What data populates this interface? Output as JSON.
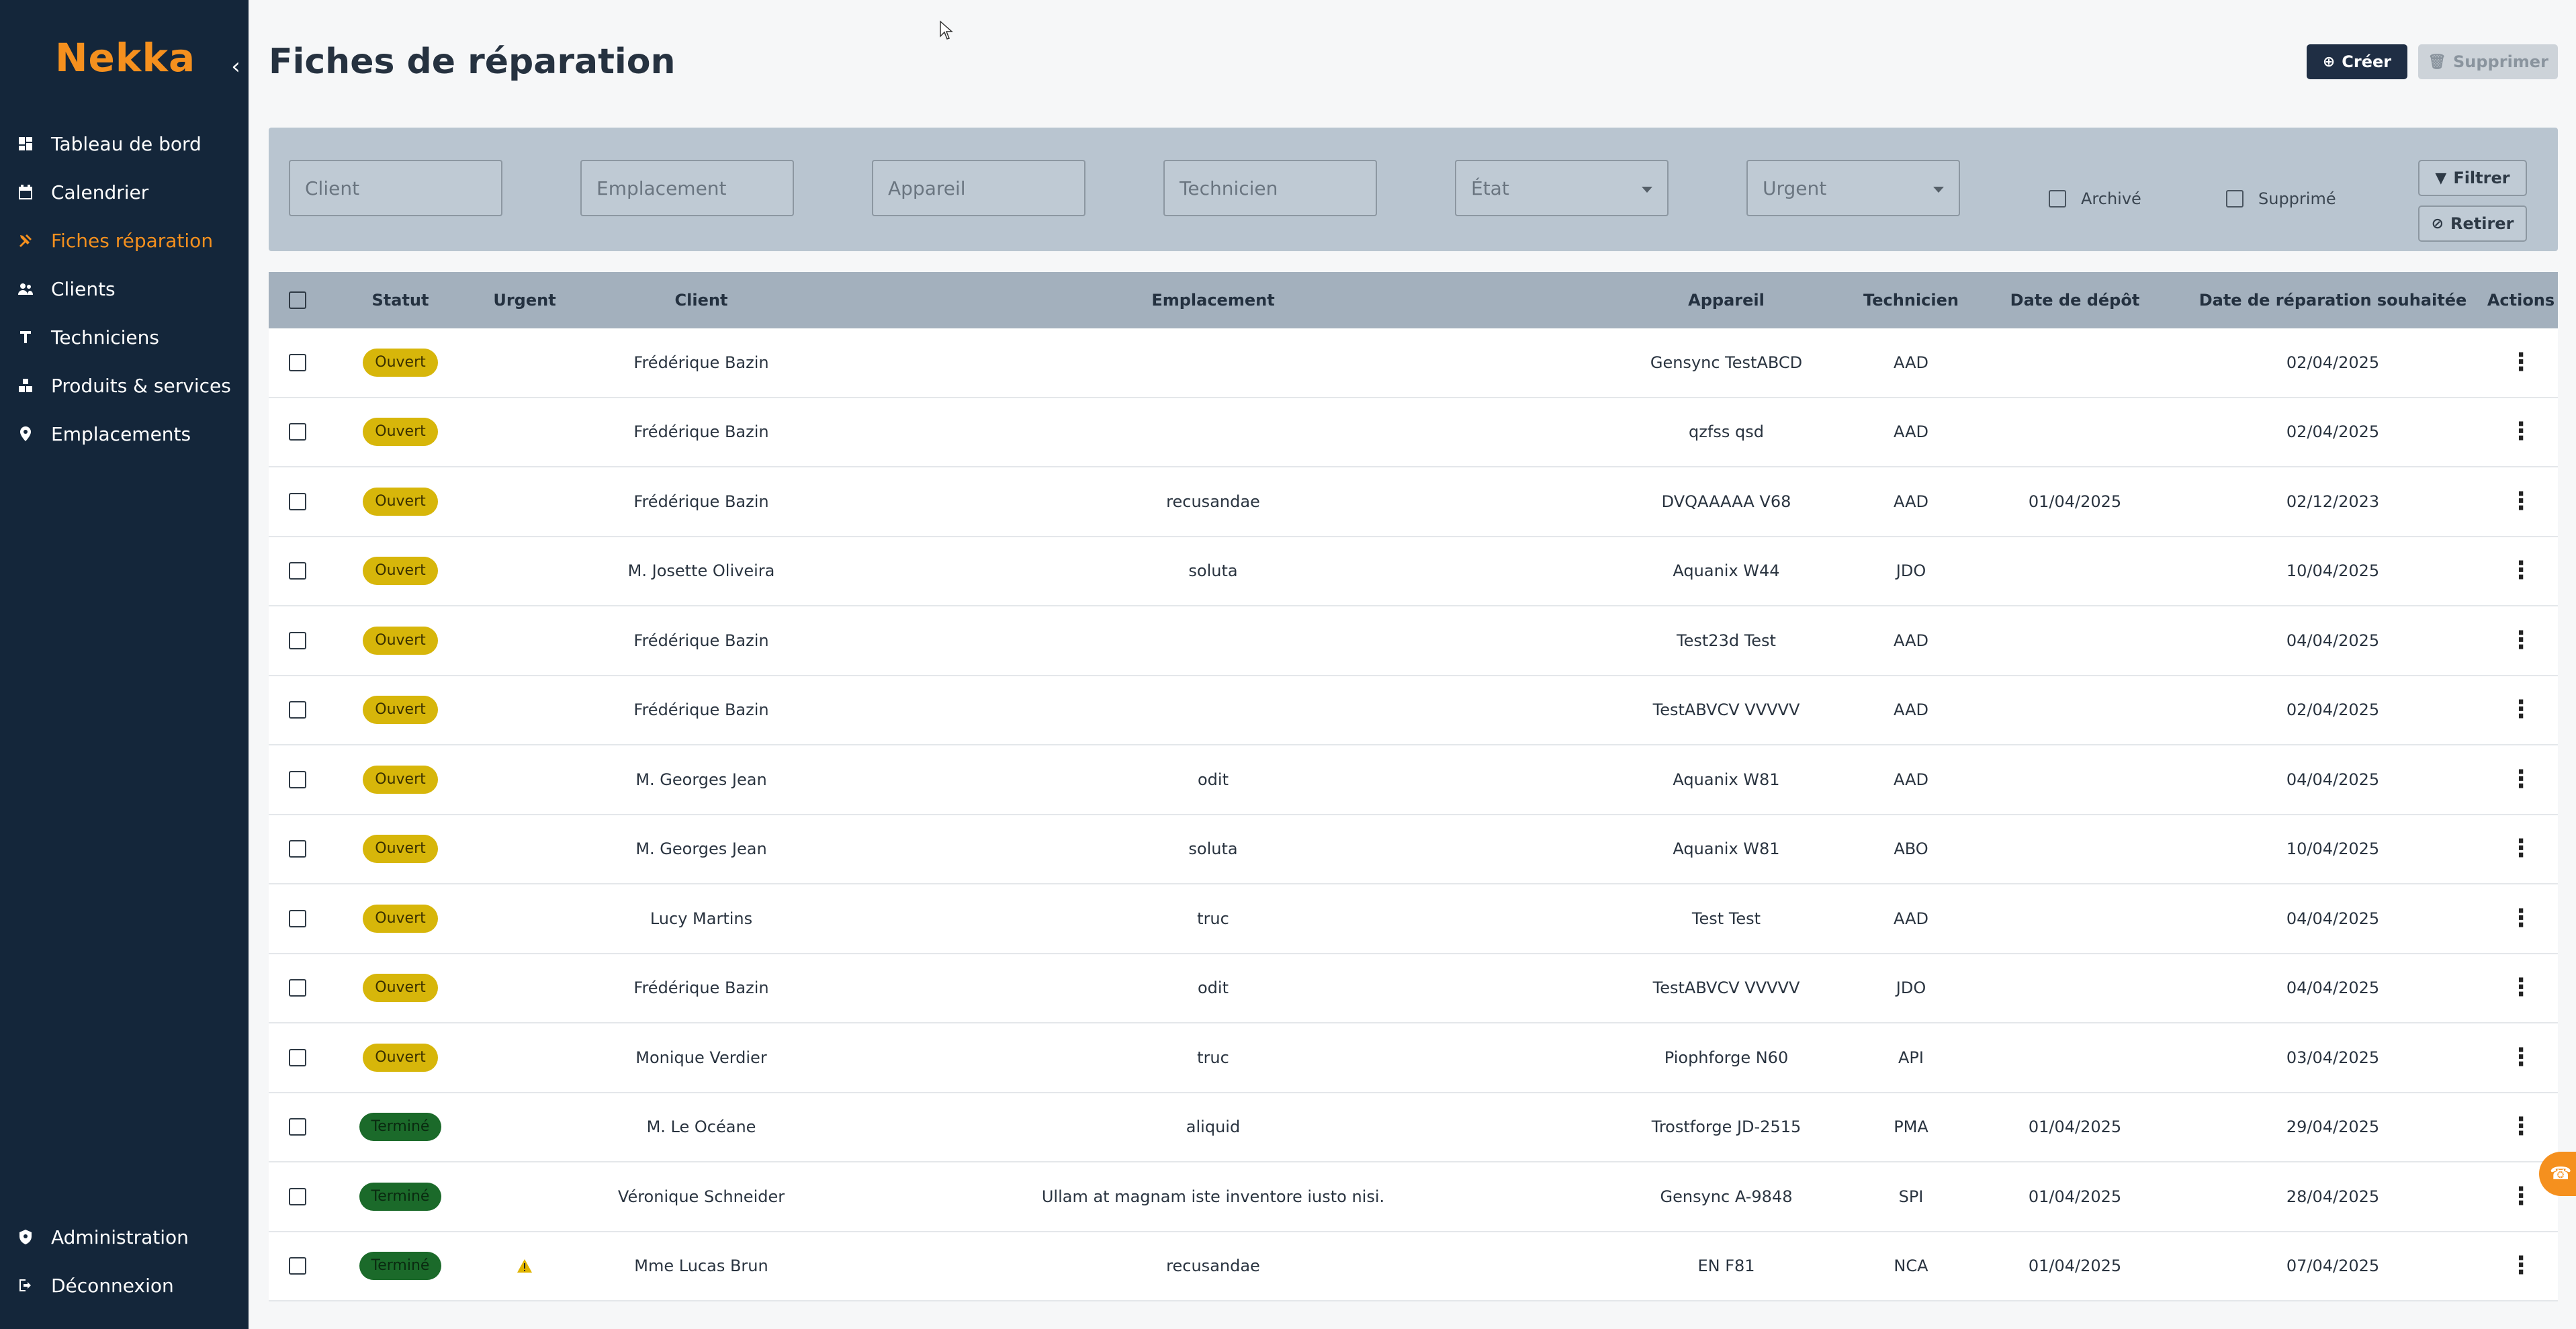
{
  "brand": {
    "name": "Nekka",
    "color": "#f5901e"
  },
  "sidebar": {
    "collapse_icon": "chevron-left-icon",
    "items": [
      {
        "label": "Tableau de bord",
        "icon": "dashboard-icon",
        "active": false
      },
      {
        "label": "Calendrier",
        "icon": "calendar-icon",
        "active": false
      },
      {
        "label": "Fiches réparation",
        "icon": "tools-icon",
        "active": true
      },
      {
        "label": "Clients",
        "icon": "users-icon",
        "active": false
      },
      {
        "label": "Techniciens",
        "icon": "technician-icon",
        "active": false
      },
      {
        "label": "Produits & services",
        "icon": "products-icon",
        "active": false
      },
      {
        "label": "Emplacements",
        "icon": "location-pin-icon",
        "active": false
      }
    ],
    "bottom_items": [
      {
        "label": "Administration",
        "icon": "shield-icon"
      },
      {
        "label": "Déconnexion",
        "icon": "logout-icon"
      }
    ]
  },
  "header": {
    "title": "Fiches de réparation",
    "create_label": "Créer",
    "delete_label": "Supprimer"
  },
  "filters": {
    "client_placeholder": "Client",
    "emplacement_placeholder": "Emplacement",
    "appareil_placeholder": "Appareil",
    "technicien_placeholder": "Technicien",
    "etat_placeholder": "État",
    "urgent_placeholder": "Urgent",
    "archive_label": "Archivé",
    "supprime_label": "Supprimé",
    "filter_label": "Filtrer",
    "reset_label": "Retirer"
  },
  "table": {
    "columns": {
      "statut": "Statut",
      "urgent": "Urgent",
      "client": "Client",
      "emplacement": "Emplacement",
      "appareil": "Appareil",
      "technicien": "Technicien",
      "depot": "Date de dépôt",
      "souhaitee": "Date de réparation souhaitée",
      "actions": "Actions"
    },
    "rows": [
      {
        "statut": "Ouvert",
        "urgent": false,
        "client": "Frédérique Bazin",
        "emplacement": "",
        "appareil": "Gensync TestABCD",
        "technicien": "AAD",
        "depot": "",
        "souhaitee": "02/04/2025"
      },
      {
        "statut": "Ouvert",
        "urgent": false,
        "client": "Frédérique Bazin",
        "emplacement": "",
        "appareil": "qzfss qsd",
        "technicien": "AAD",
        "depot": "",
        "souhaitee": "02/04/2025"
      },
      {
        "statut": "Ouvert",
        "urgent": false,
        "client": "Frédérique Bazin",
        "emplacement": "recusandae",
        "appareil": "DVQAAAAA V68",
        "technicien": "AAD",
        "depot": "01/04/2025",
        "souhaitee": "02/12/2023"
      },
      {
        "statut": "Ouvert",
        "urgent": false,
        "client": "M. Josette Oliveira",
        "emplacement": "soluta",
        "appareil": "Aquanix W44",
        "technicien": "JDO",
        "depot": "",
        "souhaitee": "10/04/2025"
      },
      {
        "statut": "Ouvert",
        "urgent": false,
        "client": "Frédérique Bazin",
        "emplacement": "",
        "appareil": "Test23d Test",
        "technicien": "AAD",
        "depot": "",
        "souhaitee": "04/04/2025"
      },
      {
        "statut": "Ouvert",
        "urgent": false,
        "client": "Frédérique Bazin",
        "emplacement": "",
        "appareil": "TestABVCV VVVVV",
        "technicien": "AAD",
        "depot": "",
        "souhaitee": "02/04/2025"
      },
      {
        "statut": "Ouvert",
        "urgent": false,
        "client": "M. Georges Jean",
        "emplacement": "odit",
        "appareil": "Aquanix W81",
        "technicien": "AAD",
        "depot": "",
        "souhaitee": "04/04/2025"
      },
      {
        "statut": "Ouvert",
        "urgent": false,
        "client": "M. Georges Jean",
        "emplacement": "soluta",
        "appareil": "Aquanix W81",
        "technicien": "ABO",
        "depot": "",
        "souhaitee": "10/04/2025"
      },
      {
        "statut": "Ouvert",
        "urgent": false,
        "client": "Lucy Martins",
        "emplacement": "truc",
        "appareil": "Test Test",
        "technicien": "AAD",
        "depot": "",
        "souhaitee": "04/04/2025"
      },
      {
        "statut": "Ouvert",
        "urgent": false,
        "client": "Frédérique Bazin",
        "emplacement": "odit",
        "appareil": "TestABVCV VVVVV",
        "technicien": "JDO",
        "depot": "",
        "souhaitee": "04/04/2025"
      },
      {
        "statut": "Ouvert",
        "urgent": false,
        "client": "Monique Verdier",
        "emplacement": "truc",
        "appareil": "Piophforge N60",
        "technicien": "API",
        "depot": "",
        "souhaitee": "03/04/2025"
      },
      {
        "statut": "Terminé",
        "urgent": false,
        "client": "M. Le Océane",
        "emplacement": "aliquid",
        "appareil": "Trostforge JD-2515",
        "technicien": "PMA",
        "depot": "01/04/2025",
        "souhaitee": "29/04/2025"
      },
      {
        "statut": "Terminé",
        "urgent": false,
        "client": "Véronique Schneider",
        "emplacement": "Ullam at magnam iste inventore iusto nisi.",
        "appareil": "Gensync A-9848",
        "technicien": "SPI",
        "depot": "01/04/2025",
        "souhaitee": "28/04/2025"
      },
      {
        "statut": "Terminé",
        "urgent": true,
        "client": "Mme Lucas Brun",
        "emplacement": "recusandae",
        "appareil": "EN F81",
        "technicien": "NCA",
        "depot": "01/04/2025",
        "souhaitee": "07/04/2025"
      }
    ]
  },
  "colors": {
    "sidebar_bg": "#14263a",
    "accent": "#f5901e",
    "status_open": "#d7b60a",
    "status_done": "#1b6a2a"
  }
}
